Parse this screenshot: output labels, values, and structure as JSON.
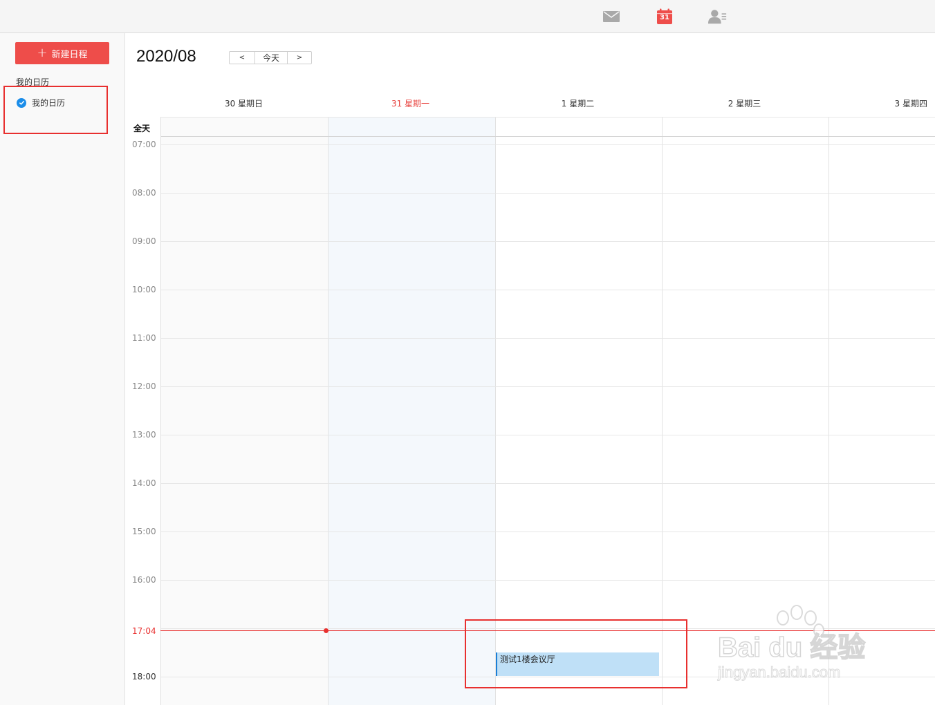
{
  "topbar": {
    "icons": [
      "mail-icon",
      "calendar-icon",
      "contacts-icon"
    ],
    "calendar_icon_number": "31"
  },
  "sidebar": {
    "new_button_label": "新建日程",
    "section_label": "我的日历",
    "calendars": [
      {
        "label": "我的日历",
        "checked": true
      }
    ]
  },
  "header": {
    "title": "2020/08",
    "prev_label": "<",
    "today_label": "今天",
    "next_label": ">"
  },
  "days": [
    {
      "label": "30 星期日"
    },
    {
      "label": "31 星期一",
      "today": true
    },
    {
      "label": "1 星期二"
    },
    {
      "label": "2 星期三"
    },
    {
      "label": "3 星期四"
    }
  ],
  "allday_label": "全天",
  "times": [
    "07:00",
    "08:00",
    "09:00",
    "10:00",
    "11:00",
    "12:00",
    "13:00",
    "14:00",
    "15:00",
    "16:00",
    "18:00"
  ],
  "now_time": "17:04",
  "events": [
    {
      "title": "测试1楼会议厅",
      "day": "1 星期二"
    }
  ],
  "watermark": {
    "brand": "Bai du 经验",
    "url": "jingyan.baidu.com"
  },
  "colors": {
    "accent_red": "#ee4d4a",
    "today_red": "#e8433f",
    "event_fill": "#bfe0f7",
    "event_border": "#1b7fd6",
    "check_blue": "#1b8de9"
  }
}
